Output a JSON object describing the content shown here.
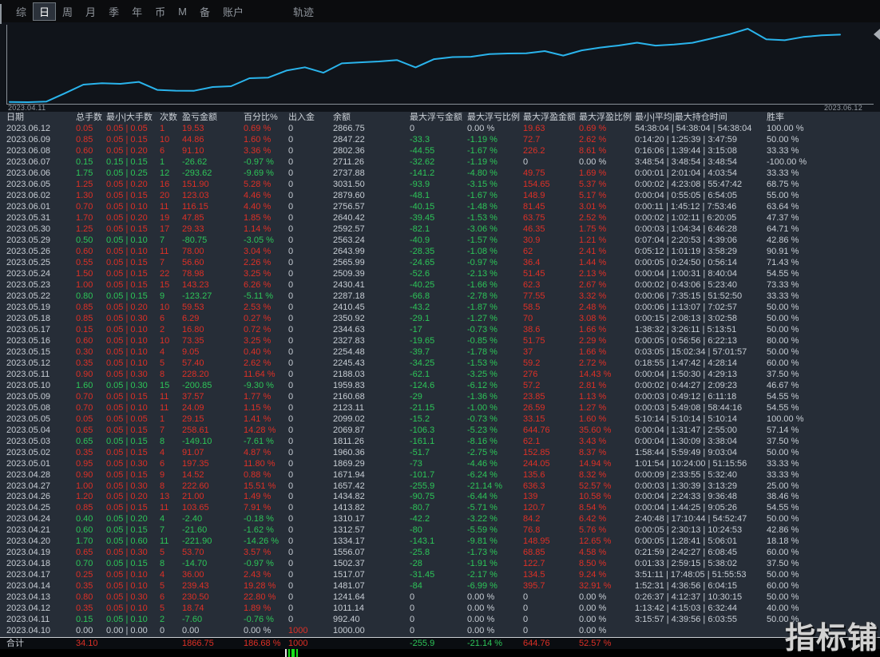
{
  "nav": {
    "items": [
      "综",
      "日",
      "周",
      "月",
      "季",
      "年",
      "币",
      "M",
      "备",
      "账户"
    ],
    "selected": "日",
    "far_item": "轨迹"
  },
  "chart": {
    "start_label": "2023.04.11",
    "end_label": "2023.06.12",
    "line_color": "#2ab4ec"
  },
  "chart_data": {
    "type": "line",
    "title": "",
    "xlabel": "",
    "ylabel": "",
    "legend_position": "none",
    "grid": false,
    "x_range": [
      "2023.04.11",
      "2023.06.12"
    ],
    "y_min": 992.4,
    "y_max": 3031.5,
    "x": [
      "2023.04.10",
      "2023.04.11",
      "2023.04.12",
      "2023.04.13",
      "2023.04.14",
      "2023.04.17",
      "2023.04.18",
      "2023.04.19",
      "2023.04.20",
      "2023.04.21",
      "2023.04.24",
      "2023.04.25",
      "2023.04.26",
      "2023.04.27",
      "2023.04.28",
      "2023.05.01",
      "2023.05.02",
      "2023.05.03",
      "2023.05.04",
      "2023.05.05",
      "2023.05.08",
      "2023.05.09",
      "2023.05.10",
      "2023.05.11",
      "2023.05.12",
      "2023.05.15",
      "2023.05.16",
      "2023.05.17",
      "2023.05.18",
      "2023.05.19",
      "2023.05.22",
      "2023.05.23",
      "2023.05.24",
      "2023.05.25",
      "2023.05.26",
      "2023.05.29",
      "2023.05.30",
      "2023.05.31",
      "2023.06.01",
      "2023.06.02",
      "2023.06.05",
      "2023.06.06",
      "2023.06.07",
      "2023.06.08",
      "2023.06.09",
      "2023.06.12"
    ],
    "series": [
      {
        "name": "余额",
        "values": [
          1000.0,
          992.4,
          1011.14,
          1241.64,
          1481.07,
          1517.07,
          1502.37,
          1556.07,
          1334.17,
          1312.57,
          1310.17,
          1413.82,
          1434.82,
          1657.42,
          1671.94,
          1869.29,
          1960.36,
          1811.26,
          2069.87,
          2099.02,
          2123.11,
          2160.68,
          1959.83,
          2188.03,
          2245.43,
          2254.48,
          2327.83,
          2344.63,
          2350.92,
          2410.45,
          2287.18,
          2430.41,
          2509.39,
          2565.99,
          2643.99,
          2563.24,
          2592.57,
          2640.42,
          2756.57,
          2879.6,
          3031.5,
          2737.88,
          2711.26,
          2802.36,
          2847.22,
          2866.75
        ]
      }
    ]
  },
  "table": {
    "headers": [
      "日期",
      "总手数",
      "最小|大手数",
      "次数",
      "盈亏金额",
      "百分比%",
      "出入金",
      "余额",
      "最大浮亏金额",
      "最大浮亏比例",
      "最大浮盈金额",
      "最大浮盈比例",
      "最小|平均|最大持仓时间",
      "胜率"
    ],
    "rows": [
      [
        "2023.06.12",
        "0.05",
        "0.05 | 0.05",
        "1",
        "19.53",
        "0.69 %",
        "0",
        "2866.75",
        "0",
        "0.00 %",
        "19.63",
        "0.69 %",
        "54:38:04 | 54:38:04 | 54:38:04",
        "100.00 %"
      ],
      [
        "2023.06.09",
        "0.85",
        "0.05 | 0.15",
        "10",
        "44.86",
        "1.60 %",
        "0",
        "2847.22",
        "-33.3",
        "-1.19 %",
        "72.7",
        "2.62 %",
        "0:14:20 | 1:25:39 | 3:47:59",
        "50.00 %"
      ],
      [
        "2023.06.08",
        "0.60",
        "0.05 | 0.20",
        "6",
        "91.10",
        "3.36 %",
        "0",
        "2802.36",
        "-44.55",
        "-1.67 %",
        "226.2",
        "8.61 %",
        "0:16:06 | 1:39:44 | 3:15:08",
        "33.33 %"
      ],
      [
        "2023.06.07",
        "0.15",
        "0.15 | 0.15",
        "1",
        "-26.62",
        "-0.97 %",
        "0",
        "2711.26",
        "-32.62",
        "-1.19 %",
        "0",
        "0.00 %",
        "3:48:54 | 3:48:54 | 3:48:54",
        "-100.00 %"
      ],
      [
        "2023.06.06",
        "1.75",
        "0.05 | 0.25",
        "12",
        "-293.62",
        "-9.69 %",
        "0",
        "2737.88",
        "-141.2",
        "-4.80 %",
        "49.75",
        "1.69 %",
        "0:00:01 | 2:01:04 | 4:03:54",
        "33.33 %"
      ],
      [
        "2023.06.05",
        "1.25",
        "0.05 | 0.20",
        "16",
        "151.90",
        "5.28 %",
        "0",
        "3031.50",
        "-93.9",
        "-3.15 %",
        "154.65",
        "5.37 %",
        "0:00:02 | 4:23:08 | 55:47:42",
        "68.75 %"
      ],
      [
        "2023.06.02",
        "1.30",
        "0.05 | 0.15",
        "20",
        "123.03",
        "4.46 %",
        "0",
        "2879.60",
        "-48.1",
        "-1.67 %",
        "148.9",
        "5.17 %",
        "0:00:04 | 0:55:05 | 6:54:05",
        "55.00 %"
      ],
      [
        "2023.06.01",
        "0.70",
        "0.05 | 0.10",
        "11",
        "116.15",
        "4.40 %",
        "0",
        "2756.57",
        "-40.15",
        "-1.48 %",
        "81.45",
        "3.01 %",
        "0:00:11 | 1:45:12 | 7:53:46",
        "63.64 %"
      ],
      [
        "2023.05.31",
        "1.70",
        "0.05 | 0.20",
        "19",
        "47.85",
        "1.85 %",
        "0",
        "2640.42",
        "-39.45",
        "-1.53 %",
        "63.75",
        "2.52 %",
        "0:00:02 | 1:02:11 | 6:20:05",
        "47.37 %"
      ],
      [
        "2023.05.30",
        "1.25",
        "0.05 | 0.15",
        "17",
        "29.33",
        "1.14 %",
        "0",
        "2592.57",
        "-82.1",
        "-3.06 %",
        "46.35",
        "1.75 %",
        "0:00:03 | 1:04:34 | 6:46:28",
        "64.71 %"
      ],
      [
        "2023.05.29",
        "0.50",
        "0.05 | 0.10",
        "7",
        "-80.75",
        "-3.05 %",
        "0",
        "2563.24",
        "-40.9",
        "-1.57 %",
        "30.9",
        "1.21 %",
        "0:07:04 | 2:20:53 | 4:39:06",
        "42.86 %"
      ],
      [
        "2023.05.26",
        "0.60",
        "0.05 | 0.10",
        "11",
        "78.00",
        "3.04 %",
        "0",
        "2643.99",
        "-28.35",
        "-1.08 %",
        "62",
        "2.41 %",
        "0:05:12 | 1:01:19 | 3:58:29",
        "90.91 %"
      ],
      [
        "2023.05.25",
        "0.55",
        "0.05 | 0.15",
        "7",
        "56.60",
        "2.26 %",
        "0",
        "2565.99",
        "-24.65",
        "-0.97 %",
        "36.4",
        "1.44 %",
        "0:00:05 | 0:24:50 | 0:56:14",
        "71.43 %"
      ],
      [
        "2023.05.24",
        "1.50",
        "0.05 | 0.15",
        "22",
        "78.98",
        "3.25 %",
        "0",
        "2509.39",
        "-52.6",
        "-2.13 %",
        "51.45",
        "2.13 %",
        "0:00:04 | 1:00:31 | 8:40:04",
        "54.55 %"
      ],
      [
        "2023.05.23",
        "1.00",
        "0.05 | 0.15",
        "15",
        "143.23",
        "6.26 %",
        "0",
        "2430.41",
        "-40.25",
        "-1.66 %",
        "62.3",
        "2.67 %",
        "0:00:02 | 0:43:06 | 5:23:40",
        "73.33 %"
      ],
      [
        "2023.05.22",
        "0.80",
        "0.05 | 0.15",
        "9",
        "-123.27",
        "-5.11 %",
        "0",
        "2287.18",
        "-66.8",
        "-2.78 %",
        "77.55",
        "3.32 %",
        "0:00:06 | 7:35:15 | 51:52:50",
        "33.33 %"
      ],
      [
        "2023.05.19",
        "0.85",
        "0.05 | 0.20",
        "10",
        "59.53",
        "2.53 %",
        "0",
        "2410.45",
        "-43.2",
        "-1.87 %",
        "58.5",
        "2.48 %",
        "0:00:06 | 1:13:07 | 7:02:57",
        "50.00 %"
      ],
      [
        "2023.05.18",
        "0.85",
        "0.05 | 0.30",
        "6",
        "6.29",
        "0.27 %",
        "0",
        "2350.92",
        "-29.1",
        "-1.27 %",
        "70",
        "3.08 %",
        "0:00:15 | 2:08:13 | 3:02:58",
        "50.00 %"
      ],
      [
        "2023.05.17",
        "0.15",
        "0.05 | 0.10",
        "2",
        "16.80",
        "0.72 %",
        "0",
        "2344.63",
        "-17",
        "-0.73 %",
        "38.6",
        "1.66 %",
        "1:38:32 | 3:26:11 | 5:13:51",
        "50.00 %"
      ],
      [
        "2023.05.16",
        "0.60",
        "0.05 | 0.10",
        "10",
        "73.35",
        "3.25 %",
        "0",
        "2327.83",
        "-19.65",
        "-0.85 %",
        "51.75",
        "2.29 %",
        "0:00:05 | 0:56:56 | 6:22:13",
        "80.00 %"
      ],
      [
        "2023.05.15",
        "0.30",
        "0.05 | 0.10",
        "4",
        "9.05",
        "0.40 %",
        "0",
        "2254.48",
        "-39.7",
        "-1.78 %",
        "37",
        "1.66 %",
        "0:03:05 | 15:02:34 | 57:01:57",
        "50.00 %"
      ],
      [
        "2023.05.12",
        "0.35",
        "0.05 | 0.10",
        "5",
        "57.40",
        "2.62 %",
        "0",
        "2245.43",
        "-34.25",
        "-1.53 %",
        "59.2",
        "2.72 %",
        "0:18:55 | 1:47:42 | 4:28:14",
        "60.00 %"
      ],
      [
        "2023.05.11",
        "0.90",
        "0.05 | 0.30",
        "8",
        "228.20",
        "11.64 %",
        "0",
        "2188.03",
        "-62.1",
        "-3.25 %",
        "276",
        "14.43 %",
        "0:00:04 | 1:50:30 | 4:29:13",
        "37.50 %"
      ],
      [
        "2023.05.10",
        "1.60",
        "0.05 | 0.30",
        "15",
        "-200.85",
        "-9.30 %",
        "0",
        "1959.83",
        "-124.6",
        "-6.12 %",
        "57.2",
        "2.81 %",
        "0:00:02 | 0:44:27 | 2:09:23",
        "46.67 %"
      ],
      [
        "2023.05.09",
        "0.70",
        "0.05 | 0.15",
        "11",
        "37.57",
        "1.77 %",
        "0",
        "2160.68",
        "-29",
        "-1.36 %",
        "23.85",
        "1.13 %",
        "0:00:03 | 0:49:12 | 6:11:18",
        "54.55 %"
      ],
      [
        "2023.05.08",
        "0.70",
        "0.05 | 0.10",
        "11",
        "24.09",
        "1.15 %",
        "0",
        "2123.11",
        "-21.15",
        "-1.00 %",
        "26.59",
        "1.27 %",
        "0:00:03 | 5:49:08 | 58:44:16",
        "54.55 %"
      ],
      [
        "2023.05.05",
        "0.05",
        "0.05 | 0.05",
        "1",
        "29.15",
        "1.41 %",
        "0",
        "2099.02",
        "-15.2",
        "-0.73 %",
        "33.15",
        "1.60 %",
        "5:10:14 | 5:10:14 | 5:10:14",
        "100.00 %"
      ],
      [
        "2023.05.04",
        "0.65",
        "0.05 | 0.15",
        "7",
        "258.61",
        "14.28 %",
        "0",
        "2069.87",
        "-106.3",
        "-5.23 %",
        "644.76",
        "35.60 %",
        "0:00:04 | 1:31:47 | 2:55:00",
        "57.14 %"
      ],
      [
        "2023.05.03",
        "0.65",
        "0.05 | 0.15",
        "8",
        "-149.10",
        "-7.61 %",
        "0",
        "1811.26",
        "-161.1",
        "-8.16 %",
        "62.1",
        "3.43 %",
        "0:00:04 | 1:30:09 | 3:38:04",
        "37.50 %"
      ],
      [
        "2023.05.02",
        "0.35",
        "0.05 | 0.15",
        "4",
        "91.07",
        "4.87 %",
        "0",
        "1960.36",
        "-51.7",
        "-2.75 %",
        "152.85",
        "8.37 %",
        "1:58:44 | 5:59:49 | 9:03:04",
        "50.00 %"
      ],
      [
        "2023.05.01",
        "0.95",
        "0.05 | 0.30",
        "6",
        "197.35",
        "11.80 %",
        "0",
        "1869.29",
        "-73",
        "-4.46 %",
        "244.05",
        "14.94 %",
        "1:01:54 | 10:24:00 | 51:15:56",
        "33.33 %"
      ],
      [
        "2023.04.28",
        "0.90",
        "0.05 | 0.15",
        "9",
        "14.52",
        "0.88 %",
        "0",
        "1671.94",
        "-101.7",
        "-6.24 %",
        "135.6",
        "8.32 %",
        "0:00:09 | 2:33:55 | 5:32:40",
        "33.33 %"
      ],
      [
        "2023.04.27",
        "1.00",
        "0.05 | 0.30",
        "8",
        "222.60",
        "15.51 %",
        "0",
        "1657.42",
        "-255.9",
        "-21.14 %",
        "636.3",
        "52.57 %",
        "0:00:03 | 1:30:39 | 3:13:29",
        "25.00 %"
      ],
      [
        "2023.04.26",
        "1.20",
        "0.05 | 0.20",
        "13",
        "21.00",
        "1.49 %",
        "0",
        "1434.82",
        "-90.75",
        "-6.44 %",
        "139",
        "10.58 %",
        "0:00:04 | 2:24:33 | 9:36:48",
        "38.46 %"
      ],
      [
        "2023.04.25",
        "0.85",
        "0.05 | 0.15",
        "11",
        "103.65",
        "7.91 %",
        "0",
        "1413.82",
        "-80.7",
        "-5.71 %",
        "120.7",
        "8.54 %",
        "0:00:04 | 1:44:25 | 9:05:26",
        "54.55 %"
      ],
      [
        "2023.04.24",
        "0.40",
        "0.05 | 0.20",
        "4",
        "-2.40",
        "-0.18 %",
        "0",
        "1310.17",
        "-42.2",
        "-3.22 %",
        "84.2",
        "6.42 %",
        "2:40:48 | 17:10:44 | 54:52:47",
        "50.00 %"
      ],
      [
        "2023.04.21",
        "0.60",
        "0.05 | 0.15",
        "7",
        "-21.60",
        "-1.62 %",
        "0",
        "1312.57",
        "-80",
        "-5.59 %",
        "76.8",
        "5.76 %",
        "0:00:05 | 2:30:13 | 10:24:53",
        "42.86 %"
      ],
      [
        "2023.04.20",
        "1.70",
        "0.05 | 0.60",
        "11",
        "-221.90",
        "-14.26 %",
        "0",
        "1334.17",
        "-143.1",
        "-9.81 %",
        "148.95",
        "12.65 %",
        "0:00:05 | 1:28:41 | 5:06:01",
        "18.18 %"
      ],
      [
        "2023.04.19",
        "0.65",
        "0.05 | 0.30",
        "5",
        "53.70",
        "3.57 %",
        "0",
        "1556.07",
        "-25.8",
        "-1.73 %",
        "68.85",
        "4.58 %",
        "0:21:59 | 2:42:27 | 6:08:45",
        "60.00 %"
      ],
      [
        "2023.04.18",
        "0.70",
        "0.05 | 0.15",
        "8",
        "-14.70",
        "-0.97 %",
        "0",
        "1502.37",
        "-28",
        "-1.91 %",
        "122.7",
        "8.50 %",
        "0:01:33 | 2:59:15 | 5:38:02",
        "37.50 %"
      ],
      [
        "2023.04.17",
        "0.25",
        "0.05 | 0.10",
        "4",
        "36.00",
        "2.43 %",
        "0",
        "1517.07",
        "-31.45",
        "-2.17 %",
        "134.5",
        "9.24 %",
        "3:51:11 | 17:48:05 | 51:55:53",
        "50.00 %"
      ],
      [
        "2023.04.14",
        "0.35",
        "0.05 | 0.10",
        "5",
        "239.43",
        "19.28 %",
        "0",
        "1481.07",
        "-84",
        "-6.99 %",
        "395.7",
        "32.91 %",
        "1:52:31 | 4:36:56 | 6:04:15",
        "60.00 %"
      ],
      [
        "2023.04.13",
        "0.80",
        "0.05 | 0.30",
        "6",
        "230.50",
        "22.80 %",
        "0",
        "1241.64",
        "0",
        "0.00 %",
        "0",
        "0.00 %",
        "0:26:37 | 4:12:37 | 10:30:15",
        "50.00 %"
      ],
      [
        "2023.04.12",
        "0.35",
        "0.05 | 0.10",
        "5",
        "18.74",
        "1.89 %",
        "0",
        "1011.14",
        "0",
        "0.00 %",
        "0",
        "0.00 %",
        "1:13:42 | 4:15:03 | 6:32:44",
        "40.00 %"
      ],
      [
        "2023.04.11",
        "0.15",
        "0.05 | 0.10",
        "2",
        "-7.60",
        "-0.76 %",
        "0",
        "992.40",
        "0",
        "0.00 %",
        "0",
        "0.00 %",
        "3:15:57 | 4:39:56 | 6:03:55",
        "50.00 %"
      ],
      [
        "2023.04.10",
        "0.00",
        "0.00 | 0.00",
        "0",
        "0.00",
        "0.00 %",
        "1000",
        "1000.00",
        "0",
        "0.00 %",
        "0",
        "0.00 %",
        "",
        ""
      ]
    ],
    "total_label": "合计",
    "total_row": [
      "合计",
      "34.10",
      "",
      "",
      "1866.75",
      "186.68 %",
      "1000",
      "",
      "-255.9",
      "-21.14 %",
      "644.76",
      "52.57 %",
      "",
      ""
    ]
  },
  "colors": {
    "profit_red": "#de3026",
    "loss_green": "#2dc558",
    "curve_cyan": "#2ab4ec",
    "table_bg": "#262d37",
    "chart_bg": "#10141a"
  },
  "watermark": "指标铺"
}
